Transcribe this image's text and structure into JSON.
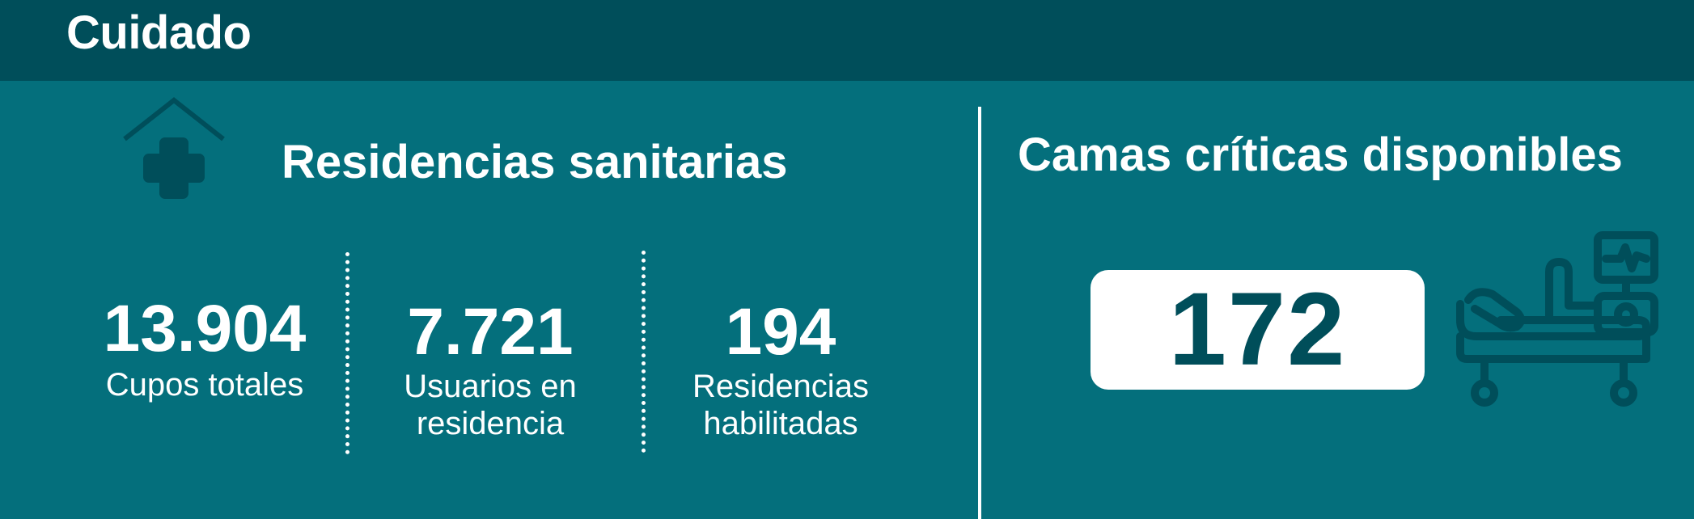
{
  "header": {
    "title": "Cuidado"
  },
  "residencias": {
    "title": "Residencias sanitarias",
    "icon": "house-medical-icon",
    "stats": [
      {
        "value": "13.904",
        "label_line1": "Cupos totales",
        "label_line2": ""
      },
      {
        "value": "7.721",
        "label_line1": "Usuarios en",
        "label_line2": "residencia"
      },
      {
        "value": "194",
        "label_line1": "Residencias",
        "label_line2": "habilitadas"
      }
    ]
  },
  "camas": {
    "title": "Camas críticas disponibles",
    "value": "172",
    "icon": "hospital-bed-icon"
  },
  "colors": {
    "header_bg": "#004e5a",
    "panel_bg": "#046f7c",
    "icon_dark": "#004e5a",
    "text": "#ffffff"
  }
}
